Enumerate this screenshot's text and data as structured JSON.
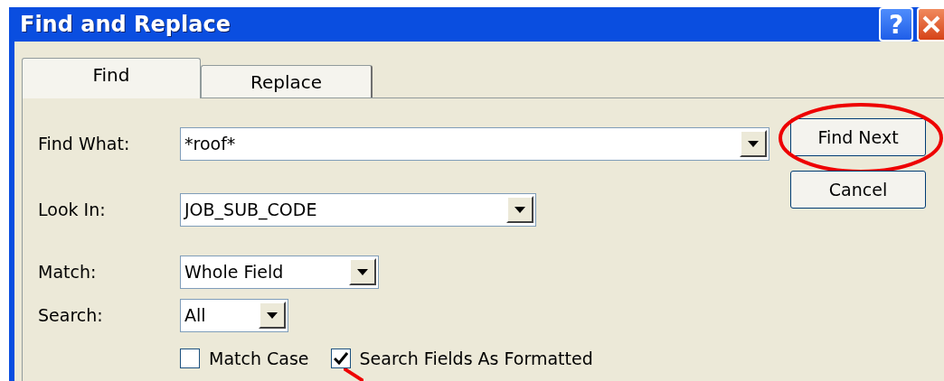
{
  "window": {
    "title": "Find and Replace",
    "help_label": "?"
  },
  "tabs": [
    {
      "label": "Find",
      "selected": true
    },
    {
      "label": "Replace",
      "selected": false
    }
  ],
  "fields": [
    {
      "label": "Find What:",
      "value": "*roof*",
      "kind": "wide"
    },
    {
      "label": "Look In:",
      "value": "JOB_SUB_CODE",
      "kind": "medium"
    },
    {
      "label": "Match:",
      "value": "Whole Field",
      "kind": "small"
    },
    {
      "label": "Search:",
      "value": "All",
      "kind": "tiny"
    }
  ],
  "checkboxes": [
    {
      "label": "Match Case",
      "checked": false,
      "pointed": false
    },
    {
      "label": "Search Fields As Formatted",
      "checked": true,
      "pointed": true
    }
  ],
  "buttons": [
    {
      "label": "Find Next",
      "circled": true
    },
    {
      "label": "Cancel",
      "circled": false
    }
  ]
}
